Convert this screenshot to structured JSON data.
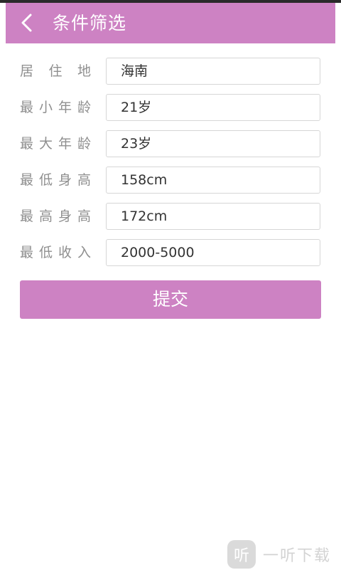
{
  "header": {
    "back_icon": "chevron-left-icon",
    "title": "条件筛选"
  },
  "form": {
    "rows": [
      {
        "label_chars": [
          "居",
          "住",
          "地"
        ],
        "value": "海南"
      },
      {
        "label_chars": [
          "最",
          "小",
          "年",
          "龄"
        ],
        "value": "21岁"
      },
      {
        "label_chars": [
          "最",
          "大",
          "年",
          "龄"
        ],
        "value": "23岁"
      },
      {
        "label_chars": [
          "最",
          "低",
          "身",
          "高"
        ],
        "value": "158cm"
      },
      {
        "label_chars": [
          "最",
          "高",
          "身",
          "高"
        ],
        "value": "172cm"
      },
      {
        "label_chars": [
          "最",
          "低",
          "收",
          "入"
        ],
        "value": "2000-5000"
      }
    ]
  },
  "submit_label": "提交",
  "watermark": {
    "badge_char": "听",
    "text": "一听下载"
  },
  "colors": {
    "accent": "#cd82c3",
    "label_text": "#8f8f8f",
    "input_border": "#d6d6d6"
  }
}
